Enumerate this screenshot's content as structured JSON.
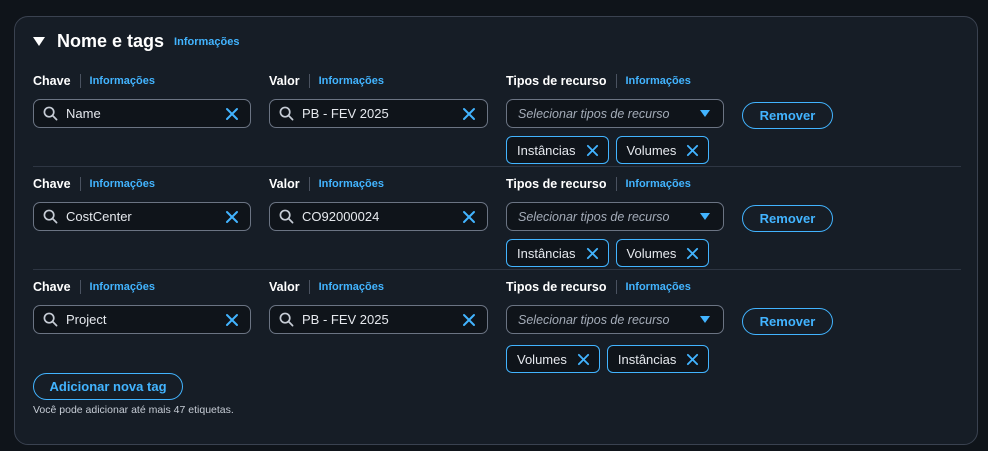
{
  "section": {
    "title": "Nome e tags",
    "info": "Informações"
  },
  "labels": {
    "key": "Chave",
    "value": "Valor",
    "resource_types": "Tipos de recurso",
    "info": "Informações",
    "select_placeholder": "Selecionar tipos de recurso",
    "remove": "Remover"
  },
  "tags": [
    {
      "key": "Name",
      "value": "PB - FEV 2025",
      "resources": [
        "Instâncias",
        "Volumes"
      ]
    },
    {
      "key": "CostCenter",
      "value": "CO92000024",
      "resources": [
        "Instâncias",
        "Volumes"
      ]
    },
    {
      "key": "Project",
      "value": "PB - FEV 2025",
      "resources": [
        "Volumes",
        "Instâncias"
      ]
    }
  ],
  "add_button": "Adicionar nova tag",
  "hint": "Você pode adicionar até mais 47 etiquetas.",
  "colors": {
    "accent": "#42b4ff",
    "panel": "#161d26",
    "input_bg": "#0f141a",
    "border": "#6b7483"
  }
}
